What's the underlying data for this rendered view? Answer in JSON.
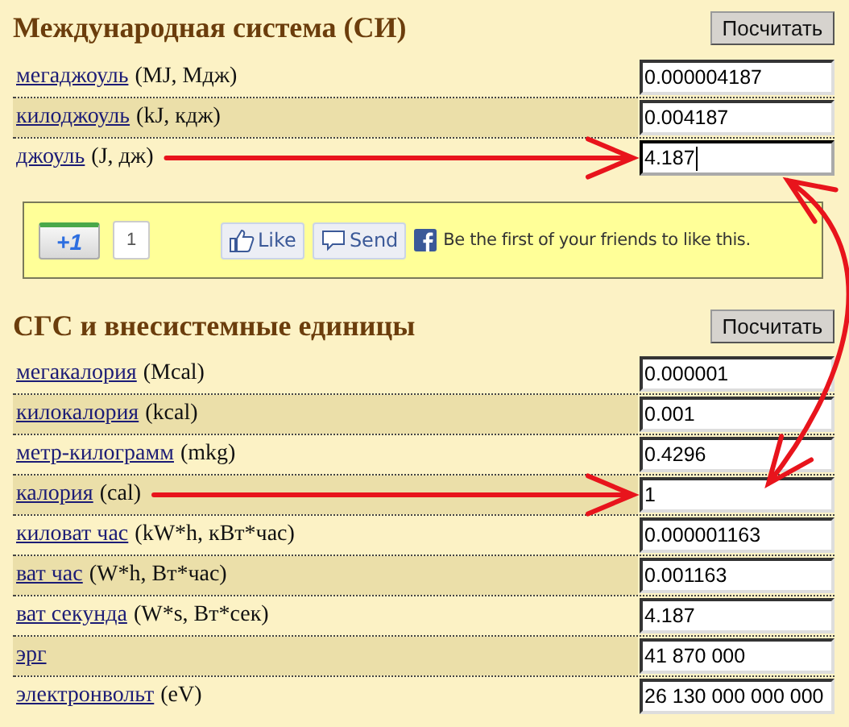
{
  "sections": [
    {
      "title": "Международная система (СИ)",
      "button": "Посчитать",
      "rows": [
        {
          "unit": "мегаджоуль",
          "symbols": "(MJ, Мдж)",
          "value": "0.000004187",
          "focused": false,
          "pointed": false
        },
        {
          "unit": "килоджоуль",
          "symbols": "(kJ, кдж)",
          "value": "0.004187",
          "focused": false,
          "pointed": false
        },
        {
          "unit": "джоуль",
          "symbols": "(J, дж)",
          "value": "4.187",
          "focused": true,
          "pointed": true
        }
      ]
    },
    {
      "title": "СГС и внесистемные единицы",
      "button": "Посчитать",
      "rows": [
        {
          "unit": "мегакалория",
          "symbols": "(Mcal)",
          "value": "0.000001",
          "focused": false,
          "pointed": false
        },
        {
          "unit": "килокалория",
          "symbols": "(kcal)",
          "value": "0.001",
          "focused": false,
          "pointed": false
        },
        {
          "unit": "метр-килограмм",
          "symbols": "(mkg)",
          "value": "0.4296",
          "focused": false,
          "pointed": false
        },
        {
          "unit": "калория",
          "symbols": "(cal)",
          "value": "1",
          "focused": false,
          "pointed": true
        },
        {
          "unit": "киловат час",
          "symbols": "(kW*h, кВт*час)",
          "value": "0.000001163",
          "focused": false,
          "pointed": false
        },
        {
          "unit": "ват час",
          "symbols": "(W*h, Вт*час)",
          "value": "0.001163",
          "focused": false,
          "pointed": false
        },
        {
          "unit": "ват секунда",
          "symbols": "(W*s, Вт*сек)",
          "value": "4.187",
          "focused": false,
          "pointed": false
        },
        {
          "unit": "эрг",
          "value": "41 870 000",
          "focused": false,
          "pointed": false
        },
        {
          "unit": "электронвольт",
          "symbols": "(eV)",
          "value": "26 130 000 000 000",
          "focused": false,
          "pointed": false
        }
      ]
    }
  ],
  "social": {
    "plus_one": "+1",
    "plus_count": "1",
    "like": "Like",
    "send": "Send",
    "message": "Be the first of your friends to like this."
  },
  "link_arrow": true
}
